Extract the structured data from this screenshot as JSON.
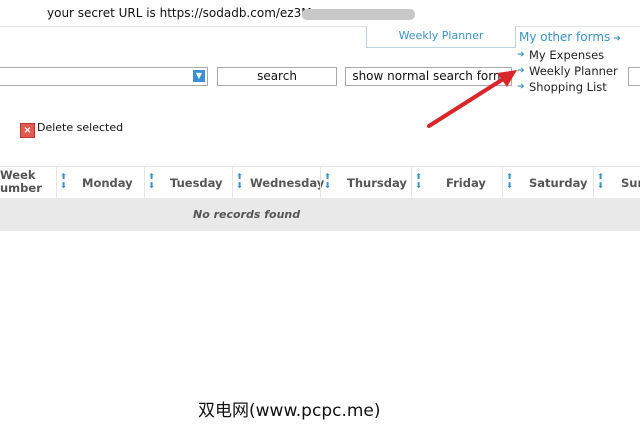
{
  "header": {
    "secret_url": "your secret URL is https://sodadb.com/ez3M"
  },
  "tabs": {
    "weekly_planner": "Weekly Planner",
    "other_forms": "My other forms",
    "other_forms_arrow_icon": "arrow-right-icon"
  },
  "forms_menu": {
    "items": [
      "My Expenses",
      "Weekly Planner",
      "Shopping List"
    ]
  },
  "toolbar": {
    "search_label": "search",
    "normal_search_label": "show normal search form",
    "delete_label": "Delete selected"
  },
  "table": {
    "columns": [
      "Week Number",
      "Monday",
      "Tuesday",
      "Wednesday",
      "Thursday",
      "Friday",
      "Saturday",
      "Sun"
    ],
    "col_week_line1": "Week",
    "col_week_line2": "umber",
    "empty_message": "No records found"
  },
  "watermark": "双电网(www.pcpc.me)",
  "colors": {
    "accent": "#3a93c6",
    "annotation_arrow": "#d9262a",
    "row_bg": "#e9e9e9"
  }
}
